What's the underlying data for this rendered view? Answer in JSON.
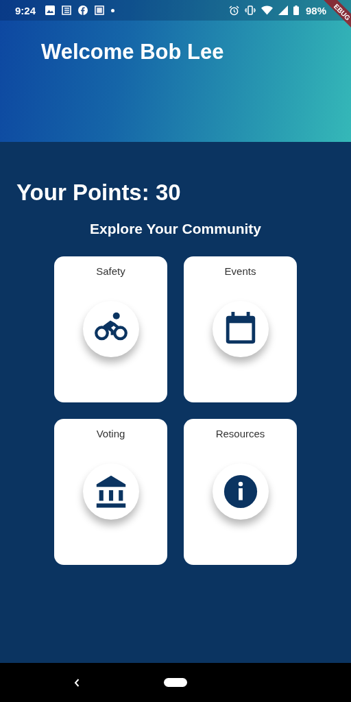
{
  "status_bar": {
    "time": "9:24",
    "battery": "98%"
  },
  "debug_banner": "EBUG",
  "header": {
    "title": "Welcome Bob Lee"
  },
  "points": "Your Points: 30",
  "section_title": "Explore Your Community",
  "cards": [
    {
      "label": "Safety",
      "kind": "bicycle"
    },
    {
      "label": "Events",
      "kind": "calendar"
    },
    {
      "label": "Voting",
      "kind": "bank"
    },
    {
      "label": "Resources",
      "kind": "info"
    }
  ]
}
